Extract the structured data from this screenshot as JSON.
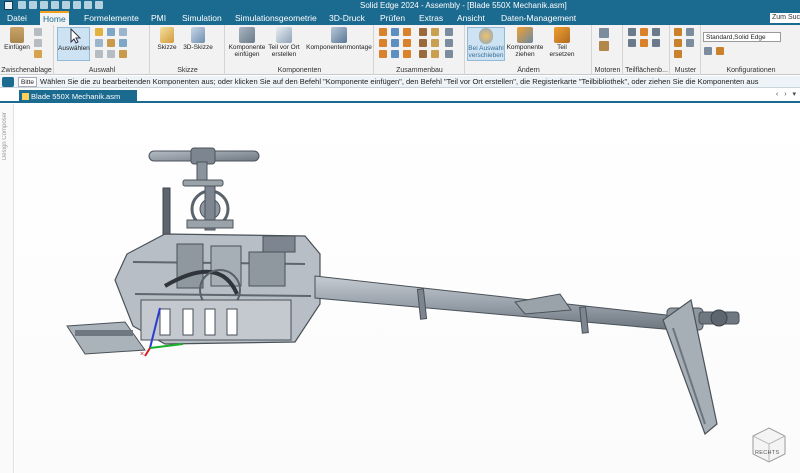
{
  "titlebar": {
    "title": "Solid Edge 2024 - Assembly - [Blade 550X Mechanik.asm]"
  },
  "menu": {
    "tabs": [
      "Datei",
      "Home",
      "Formelemente",
      "PMI",
      "Simulation",
      "Simulationsgeometrie",
      "3D-Druck",
      "Prüfen",
      "Extras",
      "Ansicht",
      "Daten-Management"
    ],
    "active": "Home",
    "search_placeholder": "Zum Suchen"
  },
  "ribbon": {
    "groups": {
      "zwischenablage": {
        "label": "Zwischenablage",
        "paste": "Einfügen"
      },
      "auswahl": {
        "label": "Auswahl",
        "select": "Auswählen"
      },
      "skizze": {
        "label": "Skizze",
        "sketch": "Skizze",
        "sketch3d": "3D-Skizze"
      },
      "komponenten": {
        "label": "Komponenten",
        "insert": "Komponente einfügen",
        "create": "Teil vor Ort erstellen",
        "assemble": "Komponentenmontage"
      },
      "zusammenbau": {
        "label": "Zusammenbau"
      },
      "aendern": {
        "label": "Ändern",
        "move": "Bei Auswahl verschieben",
        "drag": "Komponente ziehen",
        "replace": "Teil ersetzen"
      },
      "motoren": {
        "label": "Motoren"
      },
      "teilflaechen": {
        "label": "Teilflächenb..."
      },
      "muster": {
        "label": "Muster"
      },
      "konfigurationen": {
        "label": "Konfigurationen",
        "combo": "Standard,Solid Edge"
      }
    }
  },
  "prompt": {
    "badge": "Bitte",
    "message": "Wählen Sie die zu bearbeitenden Komponenten aus; oder klicken Sie auf den Befehl \"Komponente einfügen\", den Befehl \"Teil vor Ort erstellen\", die Registerkarte \"Teilbibliothek\", oder ziehen Sie die Komponenten aus"
  },
  "document": {
    "tab_label": "Blade 550X Mechanik.asm",
    "nav": "‹ › ▾"
  },
  "leftpane": {
    "label": "Design Composer"
  },
  "viewcube": {
    "label": "RECHTS"
  },
  "colors": {
    "chrome": "#1b6a8f",
    "accent": "#f0a020",
    "model": "#9aa3ad"
  }
}
